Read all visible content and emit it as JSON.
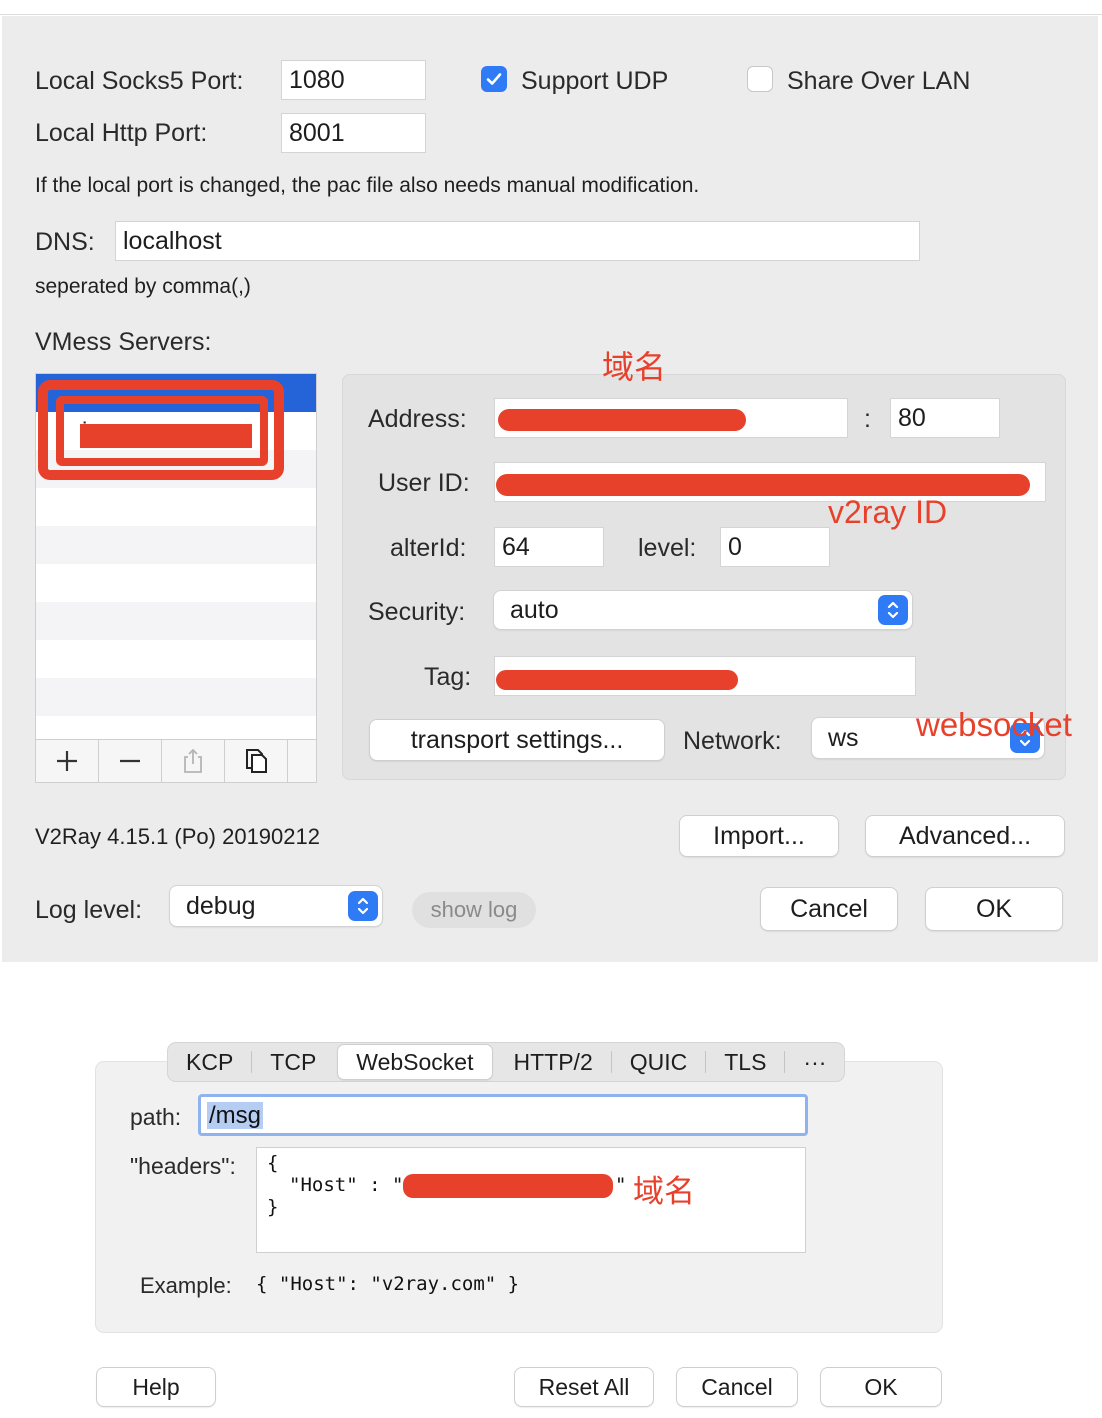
{
  "main": {
    "socks_label": "Local Socks5 Port:",
    "socks_value": "1080",
    "udp_label": "Support UDP",
    "udp_checked": true,
    "lan_label": "Share Over LAN",
    "lan_checked": false,
    "http_label": "Local Http Port:",
    "http_value": "8001",
    "port_note": "If the local port is changed, the pac file also needs manual modification.",
    "dns_label": "DNS:",
    "dns_value": "localhost",
    "dns_note": "seperated by comma(,)",
    "servers_label": "VMess Servers:",
    "server_item_visible": "i",
    "address_label": "Address:",
    "port_sep": ":",
    "port_value": "80",
    "userid_label": "User ID:",
    "alterid_label": "alterId:",
    "alterid_value": "64",
    "level_label": "level:",
    "level_value": "0",
    "security_label": "Security:",
    "security_value": "auto",
    "tag_label": "Tag:",
    "transport_button": "transport settings...",
    "network_label": "Network:",
    "network_value": "ws",
    "version": "V2Ray 4.15.1 (Po) 20190212",
    "import_button": "Import...",
    "advanced_button": "Advanced...",
    "loglevel_label": "Log level:",
    "loglevel_value": "debug",
    "showlog_button": "show log",
    "cancel_button": "Cancel",
    "ok_button": "OK",
    "list_buttons": [
      "add-icon",
      "remove-icon",
      "share-icon",
      "duplicate-icon"
    ]
  },
  "annotations": {
    "domain": "域名",
    "v2ray_id": "v2ray ID",
    "websocket": "websocket",
    "host_domain": "域名"
  },
  "transport": {
    "tabs": [
      "KCP",
      "TCP",
      "WebSocket",
      "HTTP/2",
      "QUIC",
      "TLS",
      "···"
    ],
    "active_tab": "WebSocket",
    "path_label": "path:",
    "path_value": "/msg",
    "headers_label": "\"headers\":",
    "headers_open": "{",
    "headers_host_key": "\"Host\" : \"",
    "headers_host_end": "\"",
    "headers_close": "}",
    "example_label": "Example:",
    "example_value": "{ \"Host\": \"v2ray.com\" }",
    "help_button": "Help",
    "reset_button": "Reset All",
    "cancel_button": "Cancel",
    "ok_button": "OK"
  },
  "colors": {
    "accent": "#2f7bf5",
    "redaction": "#e8412b",
    "selection": "#2563d9"
  }
}
